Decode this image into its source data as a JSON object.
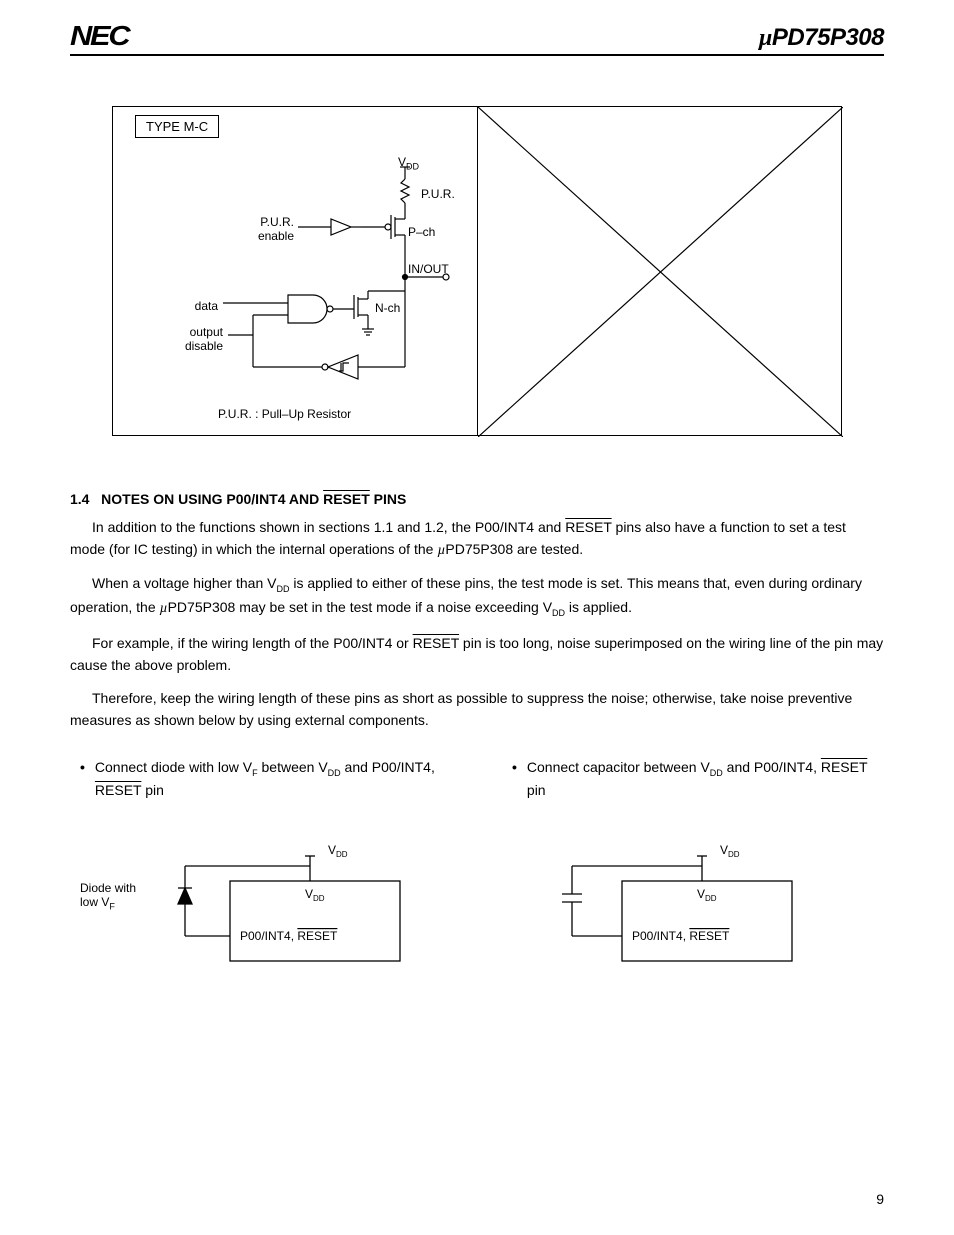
{
  "header": {
    "logo": "NEC",
    "part_number_prefix": "µ",
    "part_number": "PD75P308"
  },
  "circuit": {
    "type_label": "TYPE M-C",
    "vdd": "VDD",
    "pur": "P.U.R.",
    "pur_enable": "P.U.R.\nenable",
    "pch": "P–ch",
    "inout": "IN/OUT",
    "data": "data",
    "nch": "N-ch",
    "output_disable": "output\ndisable",
    "legend": "P.U.R. : Pull–Up Resistor"
  },
  "section": {
    "number": "1.4",
    "title_a": "NOTES ON USING P00/INT4 AND ",
    "title_reset": "RESET",
    "title_b": " PINS",
    "p1a": "In addition to the functions shown in sections 1.1 and 1.2, the P00/INT4 and ",
    "p1_reset": "RESET",
    "p1b": " pins also have a function to set a test mode (for IC testing) in which the internal operations of the ",
    "p1_mu": "µ",
    "p1c": "PD75P308 are tested.",
    "p2a": "When a voltage higher than V",
    "p2_dd1": "DD",
    "p2b": " is applied to either of these pins, the test mode is set.  This means that, even during ordinary operation, the ",
    "p2_mu": "µ",
    "p2c": "PD75P308 may be set in the test mode if a noise exceeding V",
    "p2_dd2": "DD",
    "p2d": " is applied.",
    "p3a": "For example, if the wiring length of the P00/INT4 or ",
    "p3_reset": "RESET",
    "p3b": " pin is too long, noise superimposed on the wiring line of the pin may cause the above problem.",
    "p4": "Therefore, keep the wiring length of these pins as short as possible to suppress the noise; otherwise, take noise preventive measures as shown below by using external components."
  },
  "cols": {
    "left": {
      "b1": "Connect diode with low V",
      "b1_f": "F",
      "b2": " between V",
      "b2_dd": "DD",
      "b3": " and P00/INT4, ",
      "b3_reset": "RESET",
      "b4": " pin",
      "diode_label": "Diode with\nlow V",
      "diode_f": "F",
      "vdd1": "V",
      "vdd1s": "DD",
      "vdd2": "V",
      "vdd2s": "DD",
      "pin": "P00/INT4, ",
      "pin_reset": "RESET"
    },
    "right": {
      "b1": "Connect capacitor between V",
      "b1_dd": "DD",
      "b2": " and P00/INT4, ",
      "b2_reset": "RESET",
      "b3": " pin",
      "vdd1": "V",
      "vdd1s": "DD",
      "vdd2": "V",
      "vdd2s": "DD",
      "pin": "P00/INT4, ",
      "pin_reset": "RESET"
    }
  },
  "page_number": "9"
}
